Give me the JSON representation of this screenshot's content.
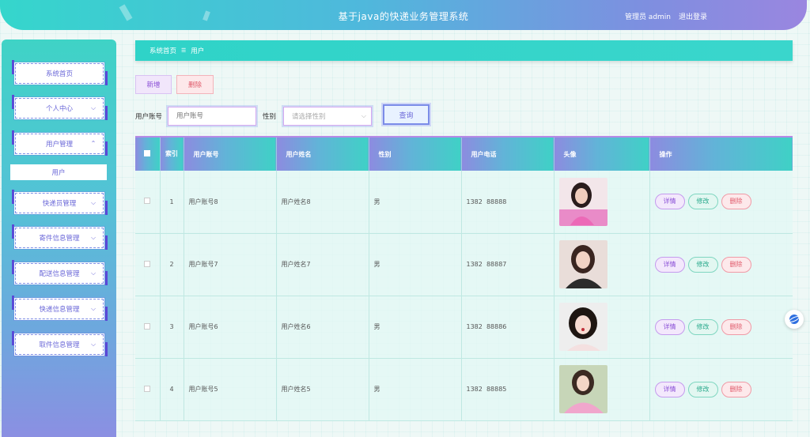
{
  "header": {
    "title": "基于java的快递业务管理系统",
    "user": "管理员 admin",
    "logout": "退出登录"
  },
  "sidebar": {
    "items": [
      {
        "label": "系统首页",
        "has_chevron": false
      },
      {
        "label": "个人中心",
        "has_chevron": true
      },
      {
        "label": "用户管理",
        "has_chevron": true,
        "expanded": true
      },
      {
        "label": "快递员管理",
        "has_chevron": true
      },
      {
        "label": "寄件信息管理",
        "has_chevron": true
      },
      {
        "label": "配送信息管理",
        "has_chevron": true
      },
      {
        "label": "快递信息管理",
        "has_chevron": true
      },
      {
        "label": "取件信息管理",
        "has_chevron": true
      }
    ],
    "submenu": "用户"
  },
  "breadcrumb": {
    "home": "系统首页",
    "sep": "☰",
    "current": "用户"
  },
  "actions": {
    "add": "新增",
    "delete": "删除"
  },
  "search": {
    "account_label": "用户账号",
    "account_placeholder": "用户账号",
    "gender_label": "性别",
    "gender_placeholder": "请选择性别",
    "query": "查询"
  },
  "table": {
    "headers": [
      "索引",
      "用户账号",
      "用户姓名",
      "性别",
      "用户电话",
      "头像",
      "操作"
    ],
    "rows": [
      {
        "index": "1",
        "account": "用户账号8",
        "name": "用户姓名8",
        "gender": "男",
        "phone": "1382  88888"
      },
      {
        "index": "2",
        "account": "用户账号7",
        "name": "用户姓名7",
        "gender": "男",
        "phone": "1382  88887"
      },
      {
        "index": "3",
        "account": "用户账号6",
        "name": "用户姓名6",
        "gender": "男",
        "phone": "1382  88886"
      },
      {
        "index": "4",
        "account": "用户账号5",
        "name": "用户姓名5",
        "gender": "男",
        "phone": "1382  88885"
      }
    ],
    "ops": {
      "detail": "详情",
      "edit": "修改",
      "delete": "删除"
    }
  },
  "colors": {
    "accent": "#3ad6cc",
    "purple": "#8a4fd6",
    "danger": "#e05a6a",
    "success": "#26a88a"
  }
}
